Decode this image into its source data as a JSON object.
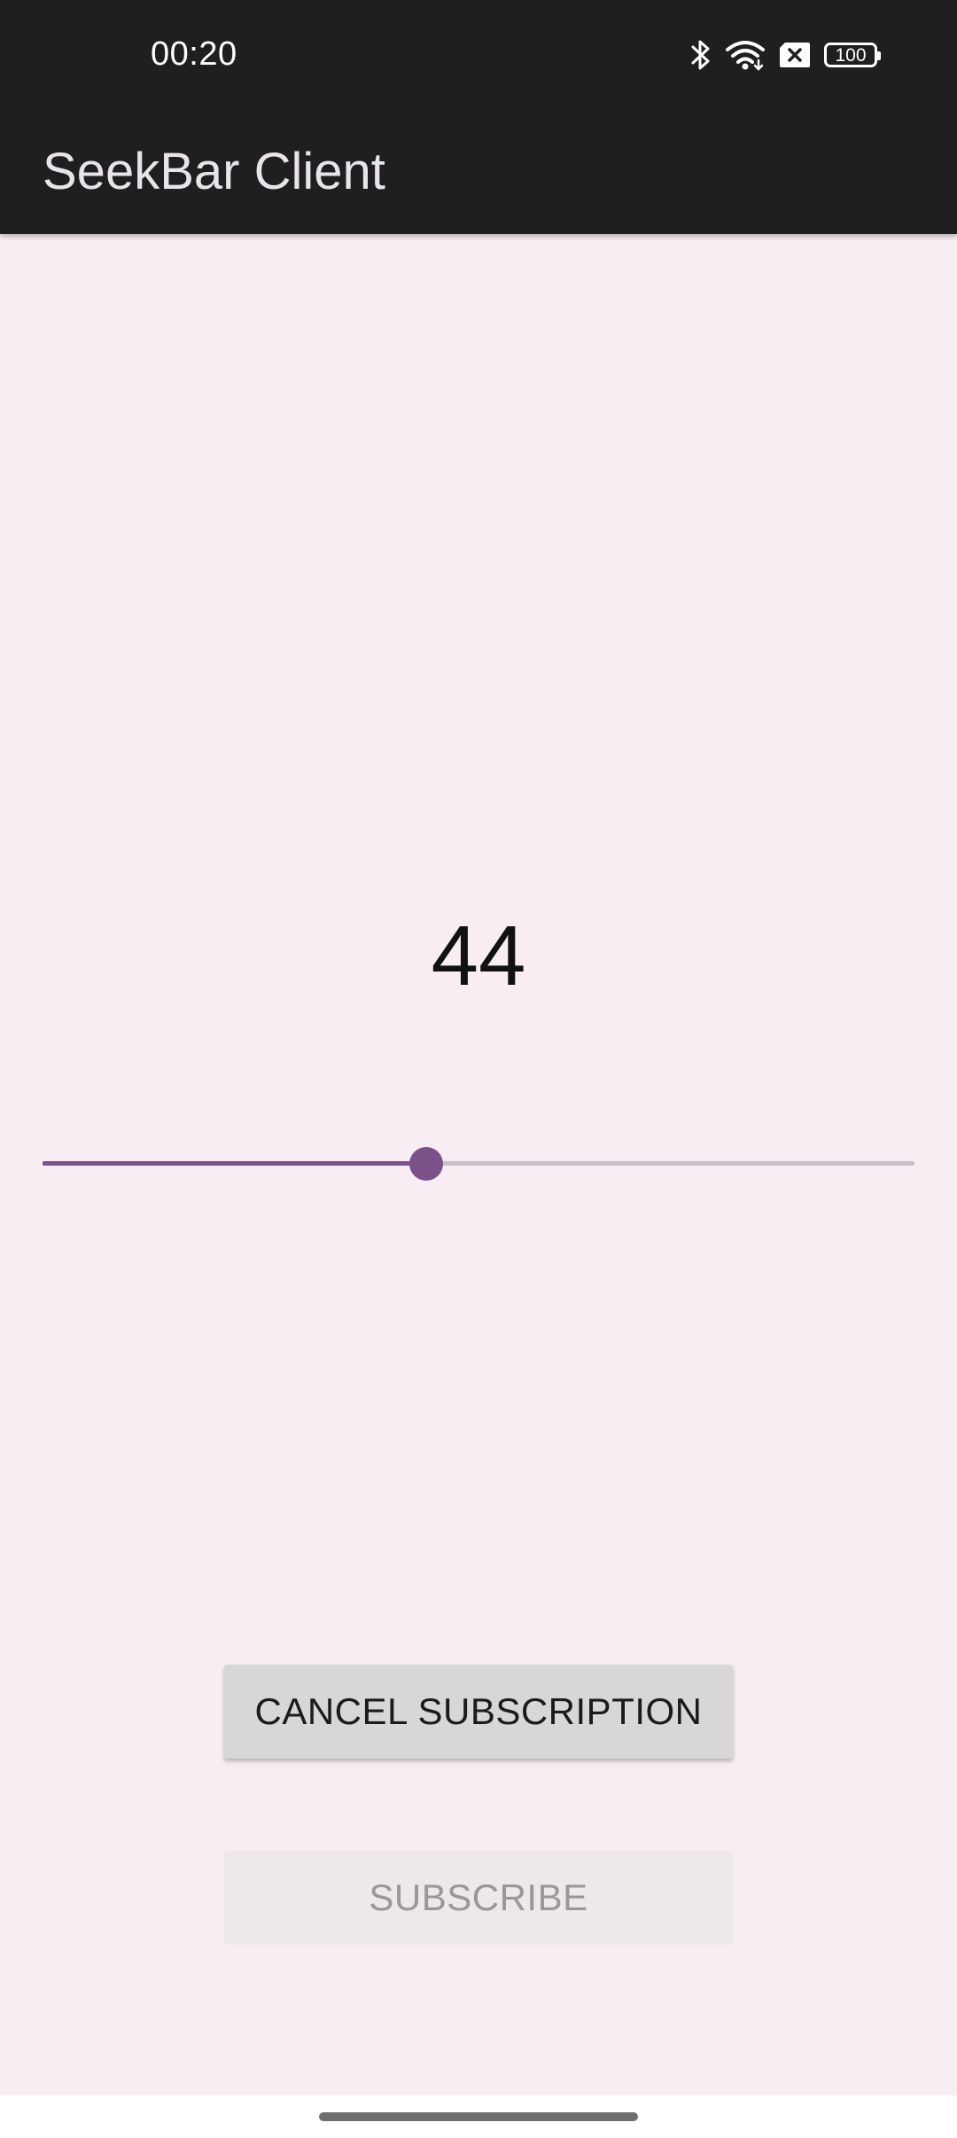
{
  "status_bar": {
    "time": "00:20",
    "icons": [
      "bluetooth-icon",
      "wifi-icon",
      "sim-off-icon",
      "battery-icon"
    ],
    "battery_level": "100"
  },
  "app_bar": {
    "title": "SeekBar Client"
  },
  "main": {
    "value_text": "44",
    "seekbar": {
      "value": 44,
      "max": 100,
      "progress_color": "#7a5189",
      "track_color": "#cbbfca"
    },
    "cancel_button_label": "CANCEL SUBSCRIPTION",
    "subscribe_button_label": "SUBSCRIBE",
    "subscribe_enabled": false
  },
  "colors": {
    "bar_background": "#1f1e20",
    "page_background": "#f7edf3",
    "accent": "#7a5189"
  }
}
